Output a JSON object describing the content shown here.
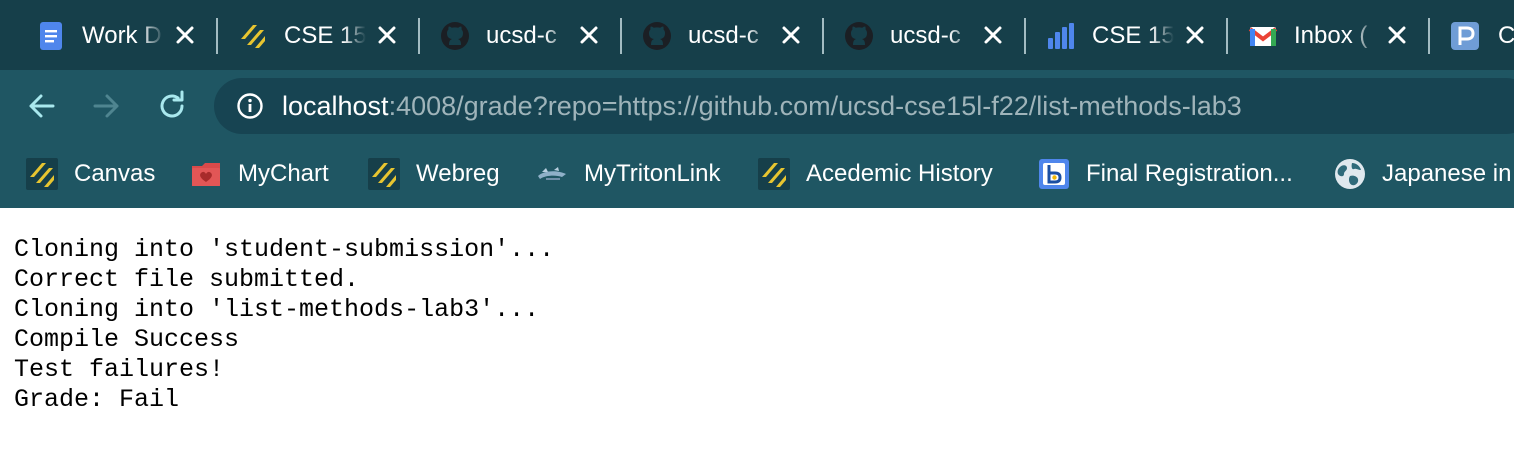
{
  "tabs": [
    {
      "title": "Work D",
      "icon": "google-docs-icon"
    },
    {
      "title": "CSE 15",
      "icon": "canvas-icon"
    },
    {
      "title": "ucsd-c",
      "icon": "github-icon"
    },
    {
      "title": "ucsd-c",
      "icon": "github-icon"
    },
    {
      "title": "ucsd-c",
      "icon": "github-icon"
    },
    {
      "title": "CSE 15",
      "icon": "bar-chart-icon"
    },
    {
      "title": "Inbox (",
      "icon": "gmail-icon"
    },
    {
      "title": "C",
      "icon": "p-app-icon"
    }
  ],
  "address_bar": {
    "host": "localhost",
    "rest": ":4008/grade?repo=https://github.com/ucsd-cse15l-f22/list-methods-lab3"
  },
  "bookmarks": [
    {
      "label": "Canvas",
      "icon": "canvas-icon"
    },
    {
      "label": "MyChart",
      "icon": "mychart-icon"
    },
    {
      "label": "Webreg",
      "icon": "canvas-icon"
    },
    {
      "label": "MyTritonLink",
      "icon": "tritonlink-icon"
    },
    {
      "label": "Acedemic History",
      "icon": "canvas-icon"
    },
    {
      "label": "Final Registration...",
      "icon": "b-icon"
    },
    {
      "label": "Japanese in",
      "icon": "globe-icon"
    }
  ],
  "output_lines": [
    "Cloning into 'student-submission'...",
    "Correct file submitted.",
    "Cloning into 'list-methods-lab3'...",
    "Compile Success",
    "Test failures!",
    "Grade: Fail"
  ],
  "colors": {
    "tab_strip": "#163f4a",
    "toolbar": "#1f5663",
    "omnibox": "#174452",
    "url_dim": "#9fb4ba",
    "canvas_yellow": "#e8c530",
    "docs_blue": "#4f86ec",
    "github_black": "#1b1f24"
  }
}
